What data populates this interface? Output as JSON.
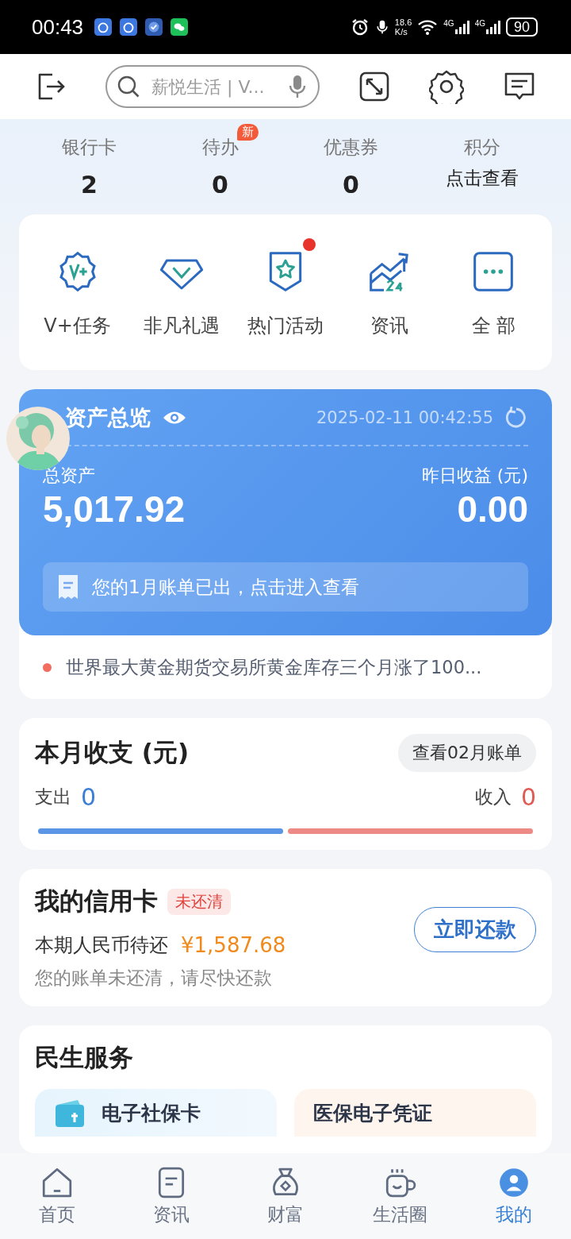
{
  "status_bar": {
    "time": "00:43",
    "speed": "18.6",
    "speed_unit": "K/s",
    "networks": [
      "4G",
      "4G"
    ],
    "battery": "90"
  },
  "toolbar": {
    "search": {
      "placeholder": "薪悦生活 | V..."
    }
  },
  "stats": [
    {
      "label": "银行卡",
      "value": "2"
    },
    {
      "label": "待办",
      "value": "0",
      "badge": "新"
    },
    {
      "label": "优惠券",
      "value": "0"
    },
    {
      "label": "积分",
      "value": "点击查看",
      "kind": "link"
    }
  ],
  "quick_actions": [
    {
      "label": "V+任务",
      "dot": false
    },
    {
      "label": "非凡礼遇",
      "dot": false
    },
    {
      "label": "热门活动",
      "dot": true
    },
    {
      "label": "资讯",
      "dot": false
    },
    {
      "label": "全 部",
      "dot": false
    }
  ],
  "assets": {
    "title": "资产总览",
    "timestamp": "2025-02-11 00:42:55",
    "total_label": "总资产",
    "total": "5,017.92",
    "yesterday_label": "昨日收益 (元)",
    "yesterday": "0.00",
    "bill_notice": "您的1月账单已出，点击进入查看"
  },
  "news": {
    "text": "世界最大黄金期货交易所黄金库存三个月涨了100..."
  },
  "monthly": {
    "title": "本月收支 (元)",
    "button": "查看02月账单",
    "expense_label": "支出",
    "expense": "0",
    "income_label": "收入",
    "income": "0"
  },
  "credit_card": {
    "title": "我的信用卡",
    "tag": "未还清",
    "due_label": "本期人民币待还",
    "amount": "¥1,587.68",
    "note": "您的账单未还清，请尽快还款",
    "button": "立即还款"
  },
  "services": {
    "title": "民生服务",
    "items": [
      {
        "label": "电子社保卡",
        "kind": "blue"
      },
      {
        "label": "医保电子凭证",
        "kind": "orange"
      }
    ]
  },
  "nav": [
    {
      "label": "首页",
      "selected": false
    },
    {
      "label": "资讯",
      "selected": false
    },
    {
      "label": "财富",
      "selected": false
    },
    {
      "label": "生活圈",
      "selected": false
    },
    {
      "label": "我的",
      "selected": true
    }
  ]
}
